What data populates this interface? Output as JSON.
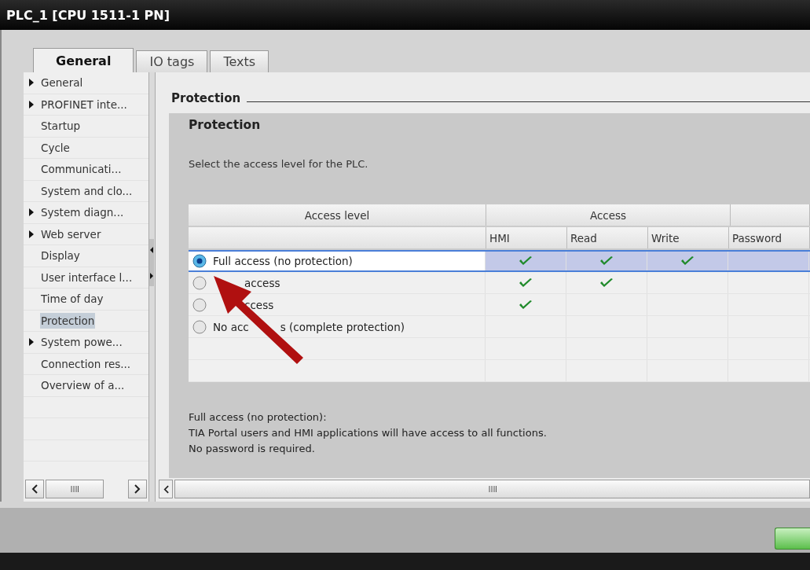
{
  "window": {
    "title": "PLC_1 [CPU 1511-1 PN]"
  },
  "tabs": [
    {
      "label": "General",
      "selected": true
    },
    {
      "label": "IO tags",
      "selected": false
    },
    {
      "label": "Texts",
      "selected": false
    }
  ],
  "sidebar": {
    "items": [
      {
        "label": "General",
        "expandable": true,
        "selected": false
      },
      {
        "label": "PROFINET inte...",
        "expandable": true,
        "selected": false
      },
      {
        "label": "Startup",
        "expandable": false,
        "selected": false
      },
      {
        "label": "Cycle",
        "expandable": false,
        "selected": false
      },
      {
        "label": "Communicati...",
        "expandable": false,
        "selected": false
      },
      {
        "label": "System and clo...",
        "expandable": false,
        "selected": false
      },
      {
        "label": "System diagn...",
        "expandable": true,
        "selected": false
      },
      {
        "label": "Web server",
        "expandable": true,
        "selected": false
      },
      {
        "label": "Display",
        "expandable": false,
        "selected": false
      },
      {
        "label": "User interface l...",
        "expandable": false,
        "selected": false
      },
      {
        "label": "Time of day",
        "expandable": false,
        "selected": false
      },
      {
        "label": "Protection",
        "expandable": false,
        "selected": true
      },
      {
        "label": "System powe...",
        "expandable": true,
        "selected": false
      },
      {
        "label": "Connection res...",
        "expandable": false,
        "selected": false
      },
      {
        "label": "Overview of a...",
        "expandable": false,
        "selected": false
      }
    ]
  },
  "section_title": "Protection",
  "group_title": "Protection",
  "instruction": "Select the access level for the PLC.",
  "table": {
    "header_groups": [
      "Access level",
      "Access"
    ],
    "columns": [
      "HMI",
      "Read",
      "Write",
      "Password"
    ],
    "rows": [
      {
        "parts": [
          {
            "text": "Full access (no protection)",
            "gap_before": false
          }
        ],
        "selected": true,
        "hmi": true,
        "read": true,
        "write": true
      },
      {
        "parts": [
          {
            "text": "access",
            "gap_before": true
          }
        ],
        "selected": false,
        "hmi": true,
        "read": true,
        "write": false
      },
      {
        "parts": [
          {
            "text": "ccess",
            "gap_before": true
          }
        ],
        "selected": false,
        "hmi": true,
        "read": false,
        "write": false
      },
      {
        "parts": [
          {
            "text": "No acc",
            "gap_before": false
          },
          {
            "text": "s (complete protection)",
            "gap_before": true
          }
        ],
        "selected": false,
        "hmi": false,
        "read": false,
        "write": false
      }
    ]
  },
  "description": [
    "Full access (no protection):",
    "TIA Portal users and HMI applications will have access to all functions.",
    "No password is required."
  ]
}
